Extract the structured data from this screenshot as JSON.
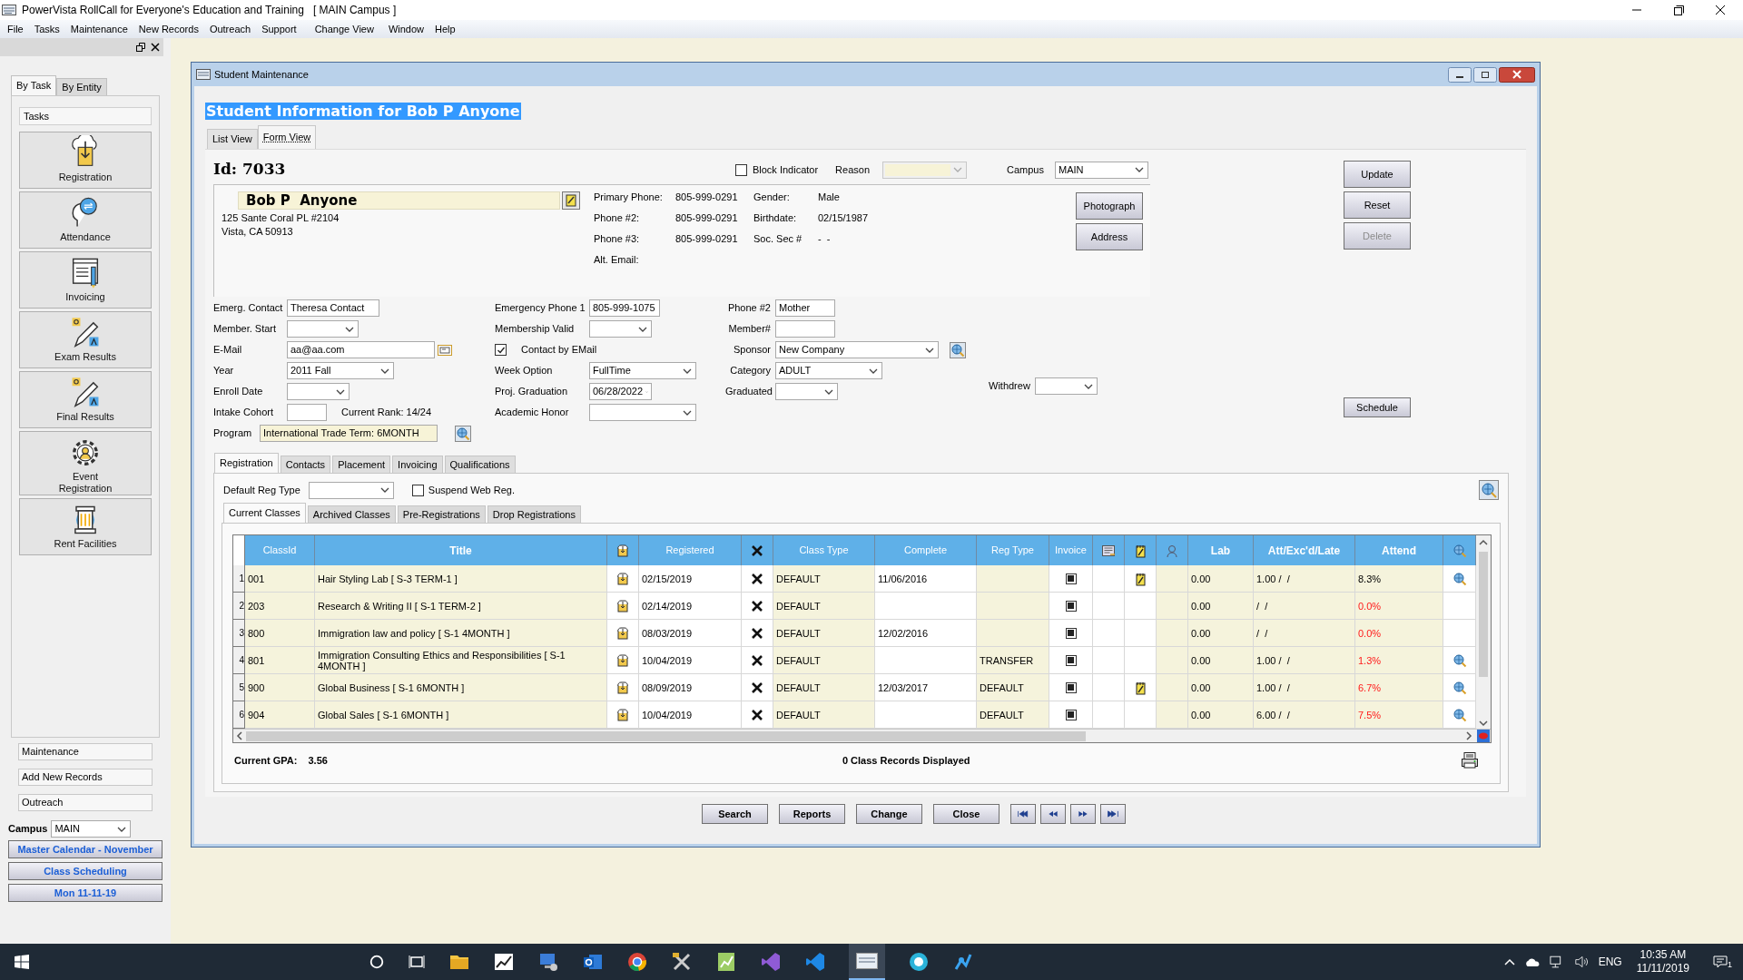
{
  "app": {
    "title": "PowerVista RollCall for Everyone's Education and Training   [ MAIN Campus ]"
  },
  "menu": [
    "File",
    "Tasks",
    "Maintenance",
    "New Records",
    "Outreach",
    "Support",
    "Change View",
    "Window",
    "Help"
  ],
  "sidebar": {
    "tabs": [
      {
        "label": "By Task",
        "selected": true
      },
      {
        "label": "By Entity",
        "selected": false
      }
    ],
    "section": "Tasks",
    "tasks": [
      "Registration",
      "Attendance",
      "Invoicing",
      "Exam Results",
      "Final Results",
      "Event Registration",
      "Rent Facilities"
    ],
    "links": [
      "Maintenance",
      "Add New Records",
      "Outreach"
    ],
    "campus_label": "Campus",
    "campus_value": "MAIN",
    "buttons": [
      "Master Calendar - November",
      "Class Scheduling",
      "Mon 11-11-19"
    ]
  },
  "window": {
    "title": "Student Maintenance",
    "heading": "Student Information for Bob P Anyone",
    "view_tabs": [
      {
        "label": "List View",
        "selected": false
      },
      {
        "label": "Form View",
        "selected": true
      }
    ]
  },
  "student": {
    "id": "Id: 7033",
    "block_indicator": {
      "label": "Block Indicator",
      "checked": false
    },
    "reason": {
      "label": "Reason",
      "disabled": true
    },
    "campus": {
      "label": "Campus",
      "value": "MAIN"
    },
    "name": "Bob P  Anyone",
    "address": [
      "125 Sante Coral PL #2104",
      "Vista, CA 50913"
    ],
    "contacts": [
      {
        "label": "Primary Phone:",
        "value": "805-999-0291"
      },
      {
        "label": "Phone #2:",
        "value": "805-999-0291"
      },
      {
        "label": "Phone #3:",
        "value": "805-999-0291"
      },
      {
        "label": "Alt. Email:"
      }
    ],
    "personal": [
      {
        "label": "Gender:",
        "value": "Male"
      },
      {
        "label": "Birthdate:",
        "value": "02/15/1987"
      },
      {
        "label": "Soc. Sec #",
        "value": "-  -"
      }
    ],
    "info_buttons": [
      "Photograph",
      "Address"
    ]
  },
  "actions": [
    {
      "label": "Update",
      "disabled": false
    },
    {
      "label": "Reset",
      "disabled": false
    },
    {
      "label": "Delete",
      "disabled": true
    }
  ],
  "schedule": "Schedule",
  "fields": [
    [
      {
        "label": "Emerg. Contact",
        "kind": "input",
        "value": "Theresa Contact"
      },
      {
        "label": "Member. Start",
        "kind": "select"
      },
      {
        "label": "E-Mail",
        "kind": "email",
        "value": "aa@aa.com"
      },
      {
        "label": "Year",
        "kind": "select",
        "value": "2011 Fall"
      },
      {
        "label": "Enroll Date",
        "kind": "select"
      },
      {
        "label": "Intake Cohort",
        "kind": "input",
        "note": "Current Rank: 14/24"
      },
      {
        "label": "Program",
        "kind": "program",
        "value": "International Trade Term: 6MONTH"
      }
    ],
    [
      {
        "label": "Emergency Phone 1",
        "kind": "input",
        "value": "805-999-1075"
      },
      {
        "label": "Membership Valid",
        "kind": "select"
      },
      {
        "label": "Contact by EMail",
        "kind": "checkbox",
        "checked": true
      },
      {
        "label": "Week Option",
        "kind": "select",
        "value": "FullTime"
      },
      {
        "label": "Proj. Graduation",
        "kind": "select",
        "value": "06/28/2022"
      },
      {
        "label": "Academic Honor",
        "kind": "select"
      }
    ],
    [
      {
        "label": "Phone #2",
        "kind": "input",
        "value": "Mother"
      },
      {
        "label": "Member#",
        "kind": "input"
      },
      {
        "label": "Sponsor",
        "kind": "lookup",
        "value": "New Company"
      },
      {
        "label": "Category",
        "kind": "select",
        "value": "ADULT"
      },
      {
        "label": "Graduated",
        "kind": "select"
      }
    ],
    [
      {
        "label": "Withdrew",
        "kind": "select"
      }
    ]
  ],
  "detail_tabs": [
    {
      "label": "Registration",
      "selected": true
    },
    {
      "label": "Contacts",
      "selected": false
    },
    {
      "label": "Placement",
      "selected": false
    },
    {
      "label": "Invoicing",
      "selected": false
    },
    {
      "label": "Qualifications",
      "selected": false
    }
  ],
  "default_reg_type": {
    "label": "Default Reg Type"
  },
  "suspend_web_reg": {
    "label": "Suspend Web Reg.",
    "checked": false
  },
  "class_tabs": [
    {
      "label": "Current Classes",
      "selected": true
    },
    {
      "label": "Archived Classes",
      "selected": false
    },
    {
      "label": "Pre-Registrations",
      "selected": false
    },
    {
      "label": "Drop Registrations",
      "selected": false
    }
  ],
  "grid": {
    "columns": [
      {
        "kind": "text",
        "label": "ClassId"
      },
      {
        "kind": "text",
        "label": "Title"
      },
      {
        "kind": "register"
      },
      {
        "kind": "text",
        "label": "Registered"
      },
      {
        "kind": "remove"
      },
      {
        "kind": "text",
        "label": "Class Type"
      },
      {
        "kind": "text",
        "label": "Complete"
      },
      {
        "kind": "text",
        "label": "Reg Type"
      },
      {
        "kind": "check",
        "label": "Invoice"
      },
      {
        "kind": "export"
      },
      {
        "kind": "note"
      },
      {
        "kind": "person"
      },
      {
        "kind": "text",
        "label": "Lab"
      },
      {
        "kind": "text",
        "label": "Att/Exc'd/Late"
      },
      {
        "kind": "text",
        "label": "Attend"
      },
      {
        "kind": "lookup"
      }
    ],
    "rows": [
      {
        "number": "1",
        "class_id": "001",
        "title": "Hair Styling Lab [ S-3 TERM-1 ]",
        "registered": "02/15/2019",
        "class_type": "DEFAULT",
        "complete": "11/06/2016",
        "invoiced": true,
        "note": true,
        "lab": "0.00",
        "att_exc_late": "1.00 /  /",
        "attend": "8.3%",
        "attend_low": false,
        "lookup": true
      },
      {
        "number": "2",
        "class_id": "203",
        "title": "Research & Writing II [ S-1 TERM-2 ]",
        "registered": "02/14/2019",
        "class_type": "DEFAULT",
        "invoiced": true,
        "note": false,
        "lab": "0.00",
        "att_exc_late": "/  /",
        "attend": "0.0%",
        "attend_low": true,
        "lookup": false
      },
      {
        "number": "3",
        "class_id": "800",
        "title": "Immigration law and policy [ S-1 4MONTH ]",
        "registered": "08/03/2019",
        "class_type": "DEFAULT",
        "complete": "12/02/2016",
        "invoiced": true,
        "note": false,
        "lab": "0.00",
        "att_exc_late": "/  /",
        "attend": "0.0%",
        "attend_low": true,
        "lookup": false
      },
      {
        "number": "4",
        "class_id": "801",
        "title": "Immigration Consulting Ethics and Responsibilities [ S-1 4MONTH ]",
        "registered": "10/04/2019",
        "class_type": "DEFAULT",
        "reg_type": "TRANSFER",
        "invoiced": true,
        "note": false,
        "lab": "0.00",
        "att_exc_late": "1.00 /  /",
        "attend": "1.3%",
        "attend_low": true,
        "lookup": true
      },
      {
        "number": "5",
        "class_id": "900",
        "title": "Global Business [ S-1 6MONTH ]",
        "registered": "08/09/2019",
        "class_type": "DEFAULT",
        "complete": "12/03/2017",
        "reg_type": "DEFAULT",
        "invoiced": true,
        "note": true,
        "lab": "0.00",
        "att_exc_late": "1.00 /  /",
        "attend": "6.7%",
        "attend_low": true,
        "lookup": true
      },
      {
        "number": "6",
        "class_id": "904",
        "title": "Global Sales [ S-1 6MONTH ]",
        "registered": "10/04/2019",
        "class_type": "DEFAULT",
        "reg_type": "DEFAULT",
        "invoiced": true,
        "note": false,
        "lab": "0.00",
        "att_exc_late": "6.00 /  /",
        "attend": "7.5%",
        "attend_low": true,
        "lookup": true
      }
    ]
  },
  "gpa_label": "Current GPA:",
  "gpa": "3.56",
  "records": "0 Class Records Displayed",
  "nav_buttons": [
    "Search",
    "Reports",
    "Change",
    "Close"
  ],
  "taskbar": {
    "language": "ENG",
    "time": "10:35 AM",
    "date": "11/11/2019",
    "notifications": "1"
  }
}
